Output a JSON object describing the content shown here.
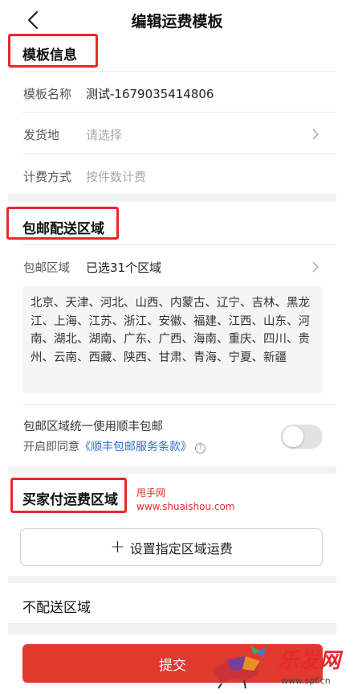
{
  "header": {
    "title": "编辑运费模板"
  },
  "template_info": {
    "section_title": "模板信息",
    "name_label": "模板名称",
    "name_value": "测试-1679035414806",
    "ship_from_label": "发货地",
    "ship_from_placeholder": "请选择",
    "billing_label": "计费方式",
    "billing_value": "按件数计费"
  },
  "free_shipping": {
    "section_title": "包邮配送区域",
    "area_label": "包邮区域",
    "area_value": "已选31个区域",
    "regions_text": "北京、天津、河北、山西、内蒙古、辽宁、吉林、黑龙江、上海、江苏、浙江、安徽、福建、江西、山东、河南、湖北、湖南、广东、广西、海南、重庆、四川、贵州、云南、西藏、陕西、甘肃、青海、宁夏、新疆",
    "sf_title": "包邮区域统一使用顺丰包邮",
    "sf_prefix": "开启即同意",
    "sf_link": "《顺丰包邮服务条款》",
    "sf_toggle_on": false
  },
  "buyer_pays": {
    "section_title": "买家付运费区域",
    "add_button": "设置指定区域运费"
  },
  "no_delivery": {
    "section_title": "不配送区域"
  },
  "submit_label": "提交",
  "watermarks": {
    "line1": "甩手网",
    "line2": "www.shuaishou.com",
    "logo_text": "乐发网",
    "logo_url": "www.spf.cn"
  },
  "colors": {
    "accent": "#e03a2e",
    "highlight": "#e8282b",
    "link": "#2a6fd6"
  }
}
